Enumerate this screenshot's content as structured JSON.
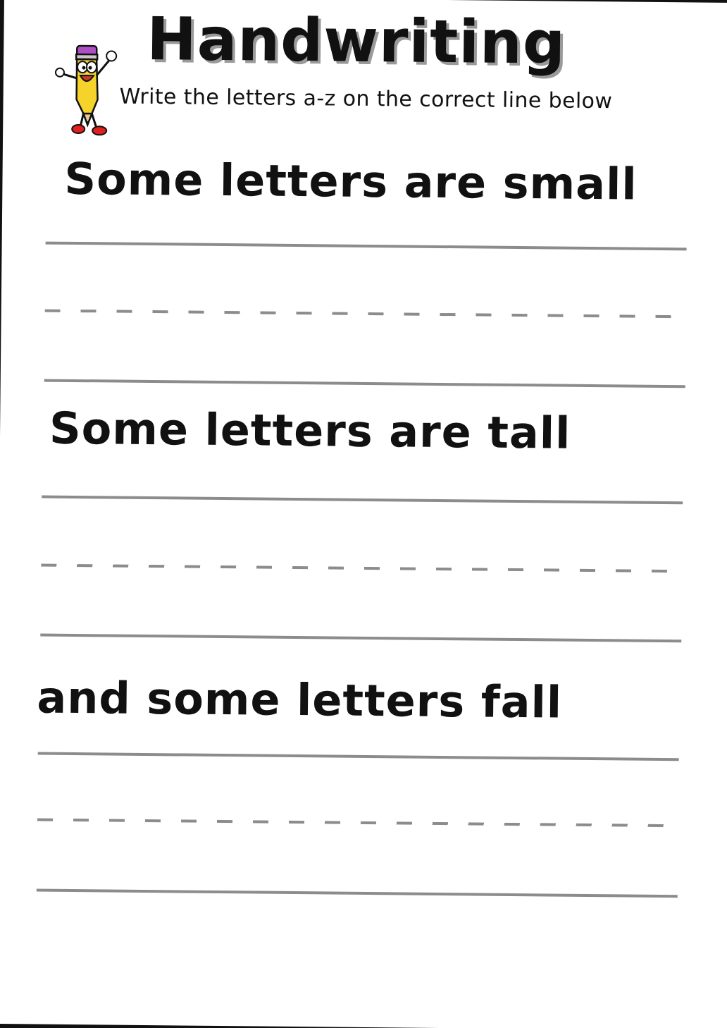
{
  "worksheet": {
    "title": "Handwriting",
    "subtitle": "Write the letters a-z on the correct line below",
    "sections": [
      {
        "heading": "Some letters are small"
      },
      {
        "heading": "Some letters are tall"
      },
      {
        "heading": "and some letters fall"
      }
    ]
  },
  "icons": {
    "mascot": "pencil-character-icon"
  },
  "colors": {
    "text": "#111111",
    "title_shadow": "#9a9a9a",
    "guide_lines": "#8c8c8c",
    "paper": "#ffffff",
    "background": "#111111"
  }
}
